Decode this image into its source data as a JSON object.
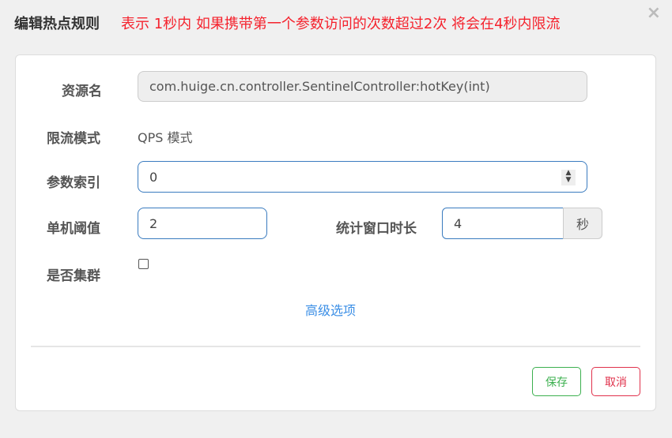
{
  "dialog": {
    "title": "编辑热点规则",
    "hint": "表示 1秒内 如果携带第一个参数访问的次数超过2次 将会在4秒内限流",
    "close": "×"
  },
  "form": {
    "resource_label": "资源名",
    "resource_value": "com.huige.cn.controller.SentinelController:hotKey(int)",
    "mode_label": "限流模式",
    "mode_value": "QPS 模式",
    "param_index_label": "参数索引",
    "param_index_value": "0",
    "threshold_label": "单机阈值",
    "threshold_value": "2",
    "window_label": "统计窗口时长",
    "window_value": "4",
    "window_unit": "秒",
    "cluster_label": "是否集群",
    "advanced_link": "高级选项"
  },
  "buttons": {
    "save": "保存",
    "cancel": "取消"
  }
}
